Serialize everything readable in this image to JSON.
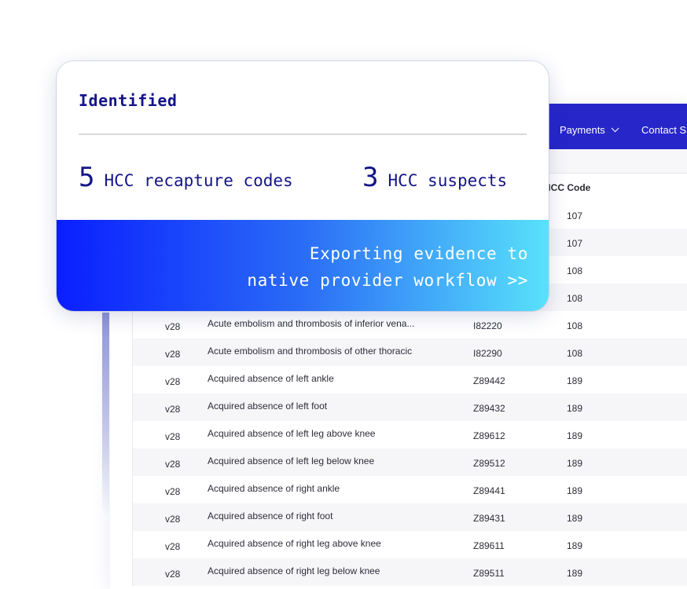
{
  "nav": {
    "payments": "Payments",
    "contact": "Contact S"
  },
  "table": {
    "hcc_header": "HCC Code",
    "hidden_hcc": [
      "107",
      "107",
      "108",
      "108"
    ],
    "rows": [
      {
        "version": "v28",
        "description": "Acute embolism and thrombosis of inferior vena...",
        "icd": "I82220",
        "hcc": "108"
      },
      {
        "version": "v28",
        "description": "Acute embolism and thrombosis of other thoracic",
        "icd": "I82290",
        "hcc": "108"
      },
      {
        "version": "v28",
        "description": "Acquired absence of left ankle",
        "icd": "Z89442",
        "hcc": "189"
      },
      {
        "version": "v28",
        "description": "Acquired absence of left foot",
        "icd": "Z89432",
        "hcc": "189"
      },
      {
        "version": "v28",
        "description": "Acquired absence of left leg above knee",
        "icd": "Z89612",
        "hcc": "189"
      },
      {
        "version": "v28",
        "description": "Acquired absence of left leg below knee",
        "icd": "Z89512",
        "hcc": "189"
      },
      {
        "version": "v28",
        "description": "Acquired absence of right ankle",
        "icd": "Z89441",
        "hcc": "189"
      },
      {
        "version": "v28",
        "description": "Acquired absence of right foot",
        "icd": "Z89431",
        "hcc": "189"
      },
      {
        "version": "v28",
        "description": "Acquired absence of right leg above knee",
        "icd": "Z89611",
        "hcc": "189"
      },
      {
        "version": "v28",
        "description": "Acquired absence of right leg below knee",
        "icd": "Z89511",
        "hcc": "189"
      }
    ]
  },
  "card": {
    "title": "Identified",
    "stat1_num": "5",
    "stat1_label": "HCC recapture codes",
    "stat2_num": "3",
    "stat2_label": "HCC suspects",
    "banner_line1": "Exporting evidence to",
    "banner_line2": "native provider workflow >>"
  },
  "colors": {
    "navbar": "#2626c9",
    "card_text": "#14148a",
    "banner_start": "#0a1eff",
    "banner_end": "#58e2fb"
  }
}
